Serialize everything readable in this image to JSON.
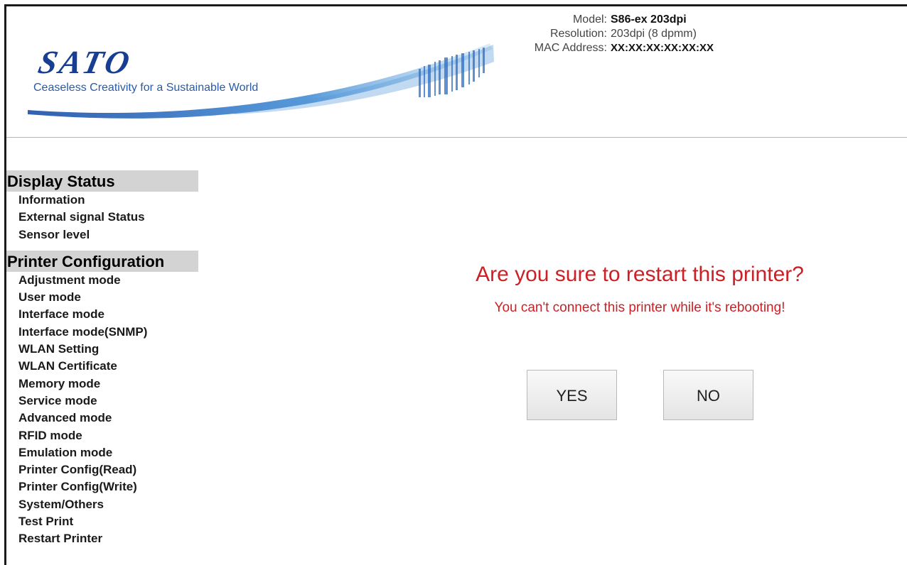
{
  "header": {
    "logo_text": "SATO",
    "tagline": "Ceaseless Creativity for a Sustainable World",
    "model_label": "Model:",
    "model_value": "S86-ex 203dpi",
    "resolution_label": "Resolution:",
    "resolution_value": "203dpi (8 dpmm)",
    "mac_label": "MAC Address:",
    "mac_value": "XX:XX:XX:XX:XX:XX"
  },
  "sidebar": {
    "sections": [
      {
        "title": "Display Status",
        "items": [
          "Information",
          "External signal Status",
          "Sensor level"
        ]
      },
      {
        "title": "Printer Configuration",
        "items": [
          "Adjustment mode",
          "User mode",
          "Interface mode",
          "Interface mode(SNMP)",
          "WLAN Setting",
          "WLAN Certificate",
          "Memory mode",
          "Service mode",
          "Advanced mode",
          "RFID mode",
          "Emulation mode",
          "Printer Config(Read)",
          "Printer Config(Write)",
          "System/Others",
          "Test Print",
          "Restart Printer"
        ]
      }
    ]
  },
  "dialog": {
    "title": "Are you sure to restart this printer?",
    "subtitle": "You can't connect this printer while it's rebooting!",
    "yes_label": "YES",
    "no_label": "NO"
  },
  "colors": {
    "brand_blue": "#173e92",
    "warning_red": "#cc2026",
    "section_bg": "#d3d3d3"
  }
}
